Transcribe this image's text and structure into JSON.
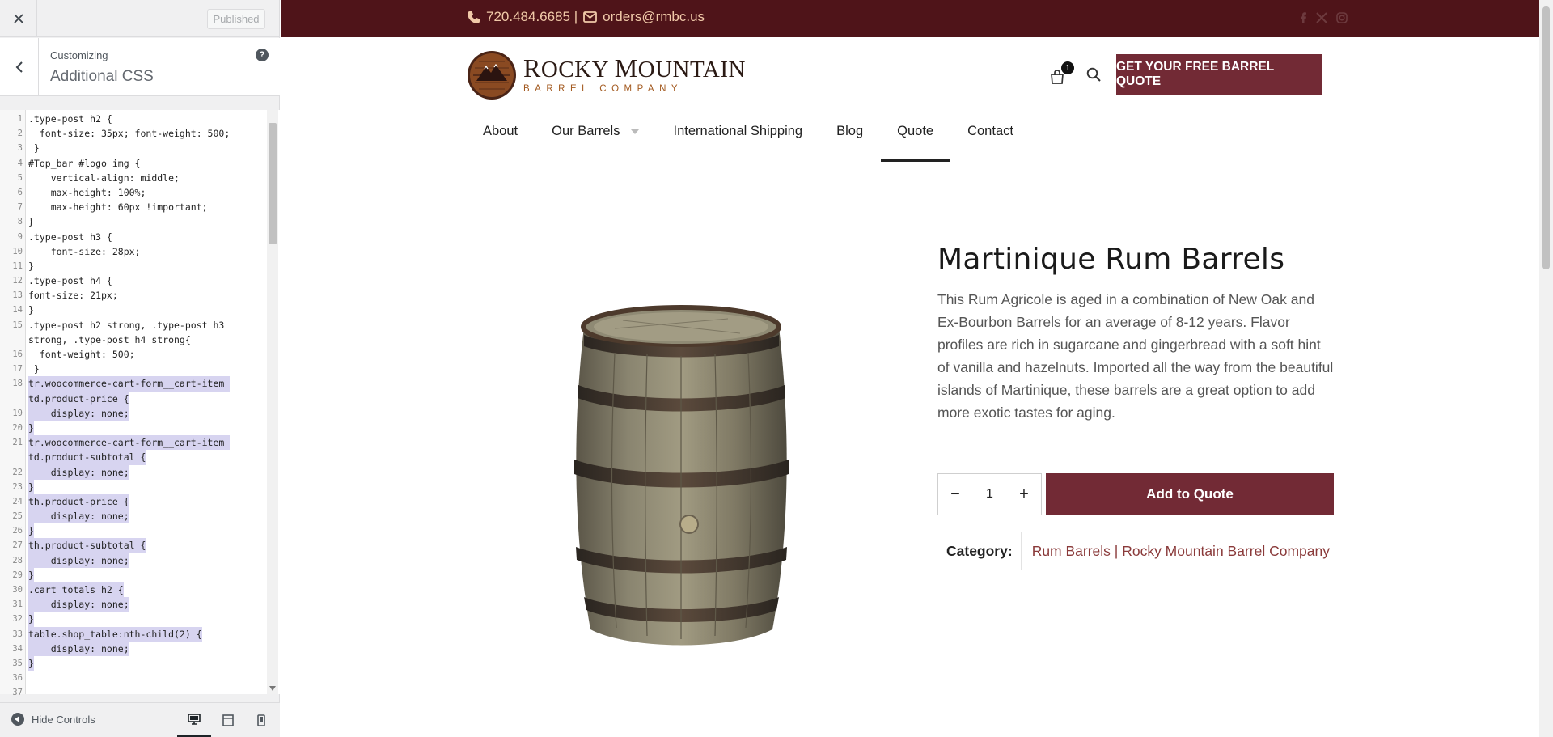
{
  "sidebar": {
    "close_label": "×",
    "published_label": "Published",
    "crumb_small": "Customizing",
    "crumb_title": "Additional CSS",
    "help_label": "?",
    "hide_controls_label": "Hide Controls",
    "code": [
      {
        "n": "1",
        "t": ".type-post h2 {",
        "s": false
      },
      {
        "n": "2",
        "t": "  font-size: 35px; font-weight: 500;",
        "s": false
      },
      {
        "n": "3",
        "t": " }",
        "s": false
      },
      {
        "n": "4",
        "t": "#Top_bar #logo img {",
        "s": false
      },
      {
        "n": "5",
        "t": "    vertical-align: middle;",
        "s": false
      },
      {
        "n": "6",
        "t": "    max-height: 100%;",
        "s": false
      },
      {
        "n": "7",
        "t": "    max-height: 60px !important;",
        "s": false
      },
      {
        "n": "8",
        "t": "}",
        "s": false
      },
      {
        "n": "9",
        "t": ".type-post h3 {",
        "s": false
      },
      {
        "n": "10",
        "t": "    font-size: 28px;",
        "s": false
      },
      {
        "n": "11",
        "t": "}",
        "s": false
      },
      {
        "n": "12",
        "t": ".type-post h4 {",
        "s": false
      },
      {
        "n": "13",
        "t": "font-size: 21px;",
        "s": false
      },
      {
        "n": "14",
        "t": "}",
        "s": false
      },
      {
        "n": "15",
        "t": ".type-post h2 strong, .type-post h3",
        "s": false
      },
      {
        "n": "",
        "t": "strong, .type-post h4 strong{",
        "s": false
      },
      {
        "n": "16",
        "t": "  font-weight: 500;",
        "s": false
      },
      {
        "n": "17",
        "t": " }",
        "s": false
      },
      {
        "n": "18",
        "t": "tr.woocommerce-cart-form__cart-item ",
        "s": true
      },
      {
        "n": "",
        "t": "td.product-price {",
        "s": true
      },
      {
        "n": "19",
        "t": "    display: none;",
        "s": true
      },
      {
        "n": "20",
        "t": "}",
        "s": true
      },
      {
        "n": "21",
        "t": "tr.woocommerce-cart-form__cart-item ",
        "s": true
      },
      {
        "n": "",
        "t": "td.product-subtotal {",
        "s": true
      },
      {
        "n": "22",
        "t": "    display: none;",
        "s": true
      },
      {
        "n": "23",
        "t": "}",
        "s": true
      },
      {
        "n": "24",
        "t": "th.product-price {",
        "s": true
      },
      {
        "n": "25",
        "t": "    display: none;",
        "s": true
      },
      {
        "n": "26",
        "t": "}",
        "s": true
      },
      {
        "n": "27",
        "t": "th.product-subtotal {",
        "s": true
      },
      {
        "n": "28",
        "t": "    display: none;",
        "s": true
      },
      {
        "n": "29",
        "t": "}",
        "s": true
      },
      {
        "n": "30",
        "t": ".cart_totals h2 {",
        "s": true
      },
      {
        "n": "31",
        "t": "    display: none;",
        "s": true
      },
      {
        "n": "32",
        "t": "}",
        "s": true
      },
      {
        "n": "33",
        "t": "table.shop_table:nth-child(2) {",
        "s": true
      },
      {
        "n": "34",
        "t": "    display: none;",
        "s": true
      },
      {
        "n": "35",
        "t": "}",
        "s": true
      },
      {
        "n": "36",
        "t": "",
        "s": false
      },
      {
        "n": "37",
        "t": "",
        "s": false
      }
    ]
  },
  "site": {
    "phone": "720.484.6685 |",
    "email": "orders@rmbc.us",
    "logo_line1_cap1": "R",
    "logo_line1_rest1": "OCKY ",
    "logo_line1_cap2": "M",
    "logo_line1_rest2": "OUNTAIN",
    "logo_line2": "BARREL COMPANY",
    "cart_count": "1",
    "quote_button": "GET YOUR FREE BARREL QUOTE",
    "nav": {
      "about": "About",
      "barrels": "Our Barrels",
      "shipping": "International Shipping",
      "blog": "Blog",
      "quote": "Quote",
      "contact": "Contact"
    },
    "product": {
      "title": "Martinique Rum Barrels",
      "description": "This Rum Agricole is aged in a combination of New Oak and Ex-Bourbon Barrels for an average of 8-12 years. Flavor profiles are rich in sugarcane and gingerbread with a soft hint of vanilla and hazelnuts. Imported all the way from the beautiful islands of Martinique, these barrels are a great option to add more exotic tastes for aging.",
      "qty": "1",
      "minus": "−",
      "plus": "+",
      "add_button": "Add to Quote",
      "category_label": "Category:",
      "category_link": "Rum Barrels | Rocky Mountain Barrel Company"
    }
  },
  "colors": {
    "topbar": "#4f1419",
    "accent": "#722a35",
    "contact_text": "#f0c9a8"
  }
}
